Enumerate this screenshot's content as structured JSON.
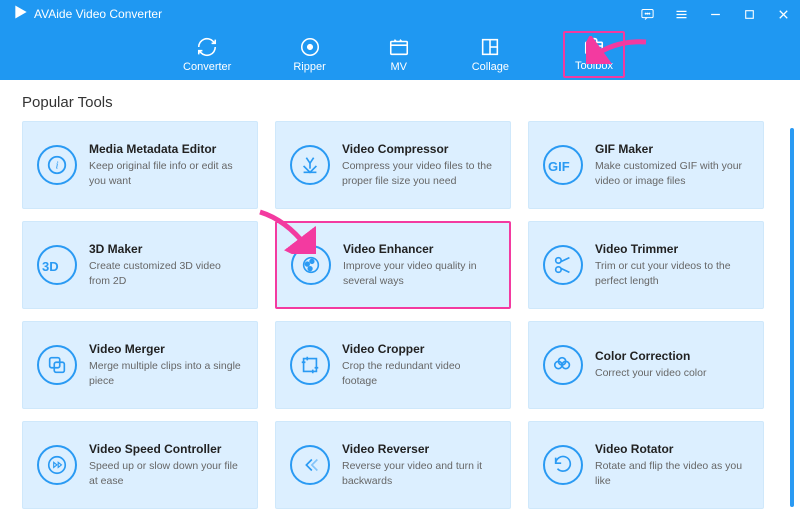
{
  "app": {
    "title": "AVAide Video Converter"
  },
  "nav": {
    "items": [
      {
        "label": "Converter"
      },
      {
        "label": "Ripper"
      },
      {
        "label": "MV"
      },
      {
        "label": "Collage"
      },
      {
        "label": "Toolbox",
        "active": true
      }
    ]
  },
  "section": {
    "title": "Popular Tools"
  },
  "tools": [
    {
      "title": "Media Metadata Editor",
      "desc": "Keep original file info or edit as you want"
    },
    {
      "title": "Video Compressor",
      "desc": "Compress your video files to the proper file size you need"
    },
    {
      "title": "GIF Maker",
      "desc": "Make customized GIF with your video or image files"
    },
    {
      "title": "3D Maker",
      "desc": "Create customized 3D video from 2D"
    },
    {
      "title": "Video Enhancer",
      "desc": "Improve your video quality in several ways",
      "highlight": true
    },
    {
      "title": "Video Trimmer",
      "desc": "Trim or cut your videos to the perfect length"
    },
    {
      "title": "Video Merger",
      "desc": "Merge multiple clips into a single piece"
    },
    {
      "title": "Video Cropper",
      "desc": "Crop the redundant video footage"
    },
    {
      "title": "Color Correction",
      "desc": "Correct your video color"
    },
    {
      "title": "Video Speed Controller",
      "desc": "Speed up or slow down your file at ease"
    },
    {
      "title": "Video Reverser",
      "desc": "Reverse your video and turn it backwards"
    },
    {
      "title": "Video Rotator",
      "desc": "Rotate and flip the video as you like"
    }
  ],
  "icons": {
    "info": "i",
    "threeD": "3D",
    "gif": "GIF"
  }
}
